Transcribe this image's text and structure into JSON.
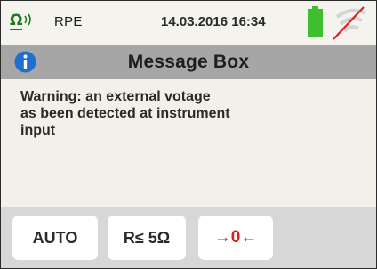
{
  "status_bar": {
    "mode_icon_symbol": "Ω",
    "mode_label": "RPE",
    "datetime": "14.03.2016 16:34",
    "battery_icon": "battery-full-icon",
    "wifi_icon": "wifi-disabled-icon",
    "colors": {
      "mode_icon": "#1e7a1e",
      "battery": "#3fbf2f",
      "wifi_slash": "#e02020"
    }
  },
  "message_box": {
    "icon": "info-icon",
    "title": "Message Box",
    "lines": [
      "Warning: an external votage",
      "as been detected at instrument",
      "input"
    ]
  },
  "softkeys": {
    "auto_label": "AUTO",
    "r_label": "R≤ 5Ω",
    "zero_label": "→0←",
    "zero_color": "#e01e1e"
  }
}
